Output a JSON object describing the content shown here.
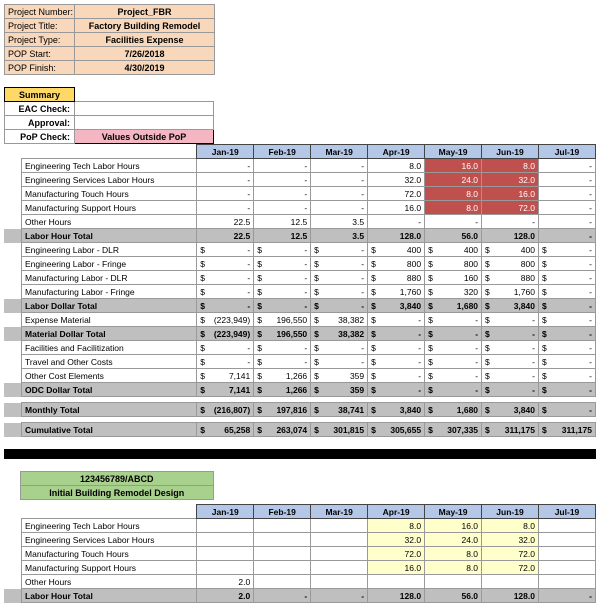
{
  "project": {
    "num_label": "Project Number:",
    "title_label": "Project Title:",
    "type_label": "Project Type:",
    "start_label": "POP Start:",
    "finish_label": "POP Finish:",
    "num": "Project_FBR",
    "title": "Factory Building Remodel",
    "type": "Facilities Expense",
    "start": "7/26/2018",
    "finish": "4/30/2019"
  },
  "summary": {
    "header": "Summary",
    "eac": "EAC Check:",
    "approval": "Approval:",
    "pop": "PoP Check:",
    "values_pop": "Values Outside PoP"
  },
  "months": [
    "Jan-19",
    "Feb-19",
    "Mar-19",
    "Apr-19",
    "May-19",
    "Jun-19",
    "Jul-19"
  ],
  "rows": {
    "eng_tech": {
      "label": "Engineering Tech Labor Hours",
      "vals": [
        "-",
        "-",
        "-",
        "8.0",
        "16.0",
        "8.0",
        "-"
      ],
      "hl": [
        0,
        0,
        0,
        0,
        1,
        1,
        0
      ]
    },
    "eng_svc": {
      "label": "Engineering Services Labor Hours",
      "vals": [
        "-",
        "-",
        "-",
        "32.0",
        "24.0",
        "32.0",
        "-"
      ],
      "hl": [
        0,
        0,
        0,
        0,
        1,
        1,
        0
      ]
    },
    "mfg_touch": {
      "label": "Manufacturing Touch Hours",
      "vals": [
        "-",
        "-",
        "-",
        "72.0",
        "8.0",
        "16.0",
        "-"
      ],
      "hl": [
        0,
        0,
        0,
        0,
        1,
        1,
        0
      ]
    },
    "mfg_sup": {
      "label": "Manufacturing Support Hours",
      "vals": [
        "-",
        "-",
        "-",
        "16.0",
        "8.0",
        "72.0",
        "-"
      ],
      "hl": [
        0,
        0,
        0,
        0,
        1,
        1,
        0
      ]
    },
    "other_h": {
      "label": "Other Hours",
      "vals": [
        "22.5",
        "12.5",
        "3.5",
        "-",
        "-",
        "-",
        "-"
      ],
      "hl": [
        0,
        0,
        0,
        0,
        0,
        0,
        0
      ]
    },
    "lab_hr_tot": {
      "label": "Labor Hour Total",
      "vals": [
        "22.5",
        "12.5",
        "3.5",
        "128.0",
        "56.0",
        "128.0",
        "-"
      ]
    },
    "eng_dlr": {
      "label": "Engineering Labor - DLR",
      "vals": [
        "-",
        "-",
        "-",
        "400",
        "400",
        "400",
        "-"
      ]
    },
    "eng_fr": {
      "label": "Engineering Labor - Fringe",
      "vals": [
        "-",
        "-",
        "-",
        "800",
        "800",
        "800",
        "-"
      ]
    },
    "mfg_dlr": {
      "label": "Manufacturing Labor - DLR",
      "vals": [
        "-",
        "-",
        "-",
        "880",
        "160",
        "880",
        "-"
      ]
    },
    "mfg_fr": {
      "label": "Manufacturing Labor - Fringe",
      "vals": [
        "-",
        "-",
        "-",
        "1,760",
        "320",
        "1,760",
        "-"
      ]
    },
    "lab_dol_tot": {
      "label": "Labor Dollar Total",
      "vals": [
        "-",
        "-",
        "-",
        "3,840",
        "1,680",
        "3,840",
        "-"
      ]
    },
    "exp_mat": {
      "label": "Expense Material",
      "vals": [
        "(223,949)",
        "196,550",
        "38,382",
        "-",
        "-",
        "-",
        "-"
      ]
    },
    "mat_tot": {
      "label": "Material Dollar Total",
      "vals": [
        "(223,949)",
        "196,550",
        "38,382",
        "-",
        "-",
        "-",
        "-"
      ]
    },
    "fac": {
      "label": "Facilities and Facilitization",
      "vals": [
        "-",
        "-",
        "-",
        "-",
        "-",
        "-",
        "-"
      ]
    },
    "trav": {
      "label": "Travel and Other Costs",
      "vals": [
        "-",
        "-",
        "-",
        "-",
        "-",
        "-",
        "-"
      ]
    },
    "other_cost": {
      "label": "Other Cost Elements",
      "vals": [
        "7,141",
        "1,266",
        "359",
        "-",
        "-",
        "-",
        "-"
      ]
    },
    "odc_tot": {
      "label": "ODC Dollar Total",
      "vals": [
        "7,141",
        "1,266",
        "359",
        "-",
        "-",
        "-",
        "-"
      ]
    },
    "month_tot": {
      "label": "Monthly Total",
      "vals": [
        "(216,807)",
        "197,816",
        "38,741",
        "3,840",
        "1,680",
        "3,840",
        "-"
      ]
    },
    "cum_tot": {
      "label": "Cumulative Total",
      "vals": [
        "65,258",
        "263,074",
        "301,815",
        "305,655",
        "307,335",
        "311,175",
        "311,175"
      ]
    }
  },
  "section2": {
    "id": "123456789/ABCD",
    "title": "Initial Building Remodel Design",
    "rows": {
      "eng_tech": {
        "label": "Engineering Tech Labor Hours",
        "vals": [
          "",
          "",
          "",
          "8.0",
          "16.0",
          "8.0",
          ""
        ],
        "hl": [
          0,
          0,
          0,
          1,
          1,
          1,
          0
        ]
      },
      "eng_svc": {
        "label": "Engineering Services Labor Hours",
        "vals": [
          "",
          "",
          "",
          "32.0",
          "24.0",
          "32.0",
          ""
        ],
        "hl": [
          0,
          0,
          0,
          1,
          1,
          1,
          0
        ]
      },
      "mfg_touch": {
        "label": "Manufacturing Touch Hours",
        "vals": [
          "",
          "",
          "",
          "72.0",
          "8.0",
          "72.0",
          ""
        ],
        "hl": [
          0,
          0,
          0,
          1,
          1,
          1,
          0
        ]
      },
      "mfg_sup": {
        "label": "Manufacturing Support Hours",
        "vals": [
          "",
          "",
          "",
          "16.0",
          "8.0",
          "72.0",
          ""
        ],
        "hl": [
          0,
          0,
          0,
          1,
          1,
          1,
          0
        ]
      },
      "other_h": {
        "label": "Other Hours",
        "vals": [
          "2.0",
          "",
          "",
          "",
          "",
          "",
          ""
        ],
        "hl": [
          0,
          0,
          0,
          0,
          0,
          0,
          0
        ]
      },
      "lab_hr_tot": {
        "label": "Labor Hour Total",
        "vals": [
          "2.0",
          "-",
          "-",
          "128.0",
          "56.0",
          "128.0",
          "-"
        ]
      }
    }
  }
}
